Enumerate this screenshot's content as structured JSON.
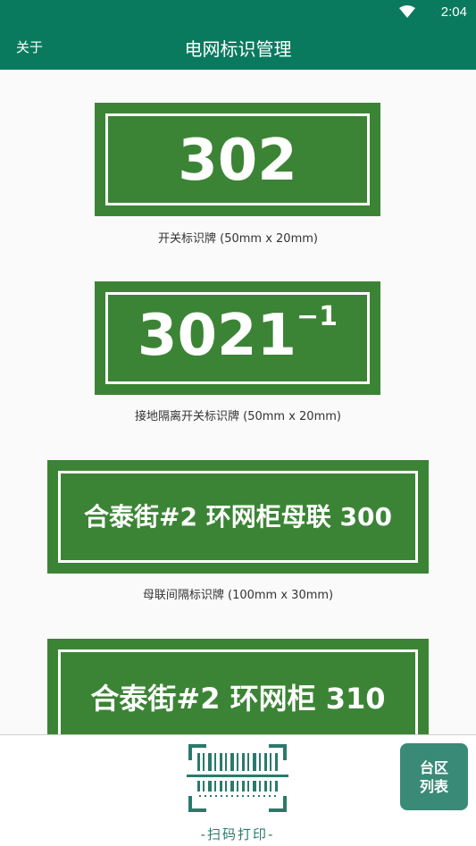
{
  "status": {
    "time": "2:04"
  },
  "appbar": {
    "about_label": "关于",
    "title": "电网标识管理"
  },
  "signs": [
    {
      "main": "302",
      "sup": "",
      "caption": "开关标识牌 (50mm x 20mm)"
    },
    {
      "main": "3021",
      "sup": "−1",
      "caption": "接地隔离开关标识牌 (50mm x 20mm)"
    },
    {
      "main": "合泰街#2 环网柜母联 300",
      "sup": "",
      "caption": "母联间隔标识牌 (100mm x 30mm)"
    },
    {
      "main": "合泰街#2 环网柜 310",
      "sup": "",
      "caption": ""
    }
  ],
  "bottom": {
    "scan_label": "-扫码打印-",
    "area_button_line1": "台区",
    "area_button_line2": "列表"
  },
  "colors": {
    "primary": "#0a7a5f",
    "sign_green": "#3c8435",
    "accent": "#3a8a78"
  }
}
